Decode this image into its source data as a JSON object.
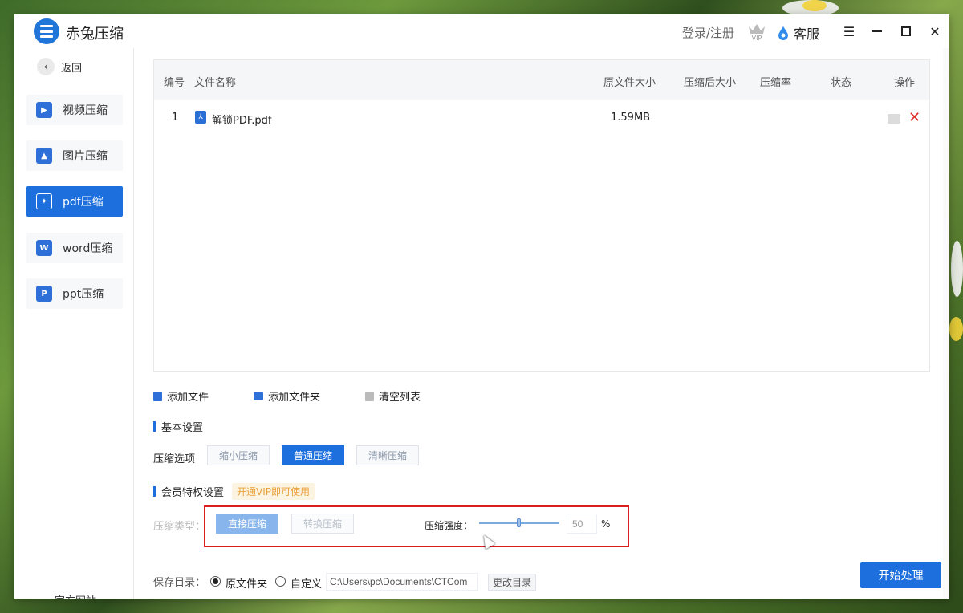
{
  "app": {
    "title": "赤兔压缩"
  },
  "header": {
    "login": "登录/注册",
    "vip_icon": "vip-crown-icon",
    "customer_service": "客服"
  },
  "sidebar": {
    "back": "返回",
    "items": [
      {
        "label": "视频压缩",
        "icon": "video-icon",
        "color": "#2f6fd8"
      },
      {
        "label": "图片压缩",
        "icon": "image-icon",
        "color": "#2f6fd8"
      },
      {
        "label": "pdf压缩",
        "icon": "pdf-icon",
        "color": "#ffffff",
        "active": true
      },
      {
        "label": "word压缩",
        "icon": "word-icon",
        "color": "#2f6fd8"
      },
      {
        "label": "ppt压缩",
        "icon": "ppt-icon",
        "color": "#2f6fd8"
      }
    ],
    "official_site": "官方网站"
  },
  "table": {
    "columns": [
      "编号",
      "文件名称",
      "原文件大小",
      "压缩后大小",
      "压缩率",
      "状态",
      "操作"
    ],
    "rows": [
      {
        "no": "1",
        "name": "解锁PDF.pdf",
        "original_size": "1.59MB",
        "compressed_size": "",
        "rate": "",
        "status": ""
      }
    ]
  },
  "actions": {
    "add_file": "添加文件",
    "add_folder": "添加文件夹",
    "clear_list": "清空列表"
  },
  "basic_settings": {
    "title": "基本设置",
    "option_label": "压缩选项",
    "options": [
      "缩小压缩",
      "普通压缩",
      "清晰压缩"
    ],
    "selected": "普通压缩"
  },
  "vip_settings": {
    "title": "会员特权设置",
    "tag": "开通VIP即可使用",
    "type_label": "压缩类型：",
    "types": [
      "直接压缩",
      "转换压缩"
    ],
    "strength_label": "压缩强度：",
    "strength_value": "50",
    "strength_unit": "%"
  },
  "save": {
    "label": "保存目录：",
    "option_original": "原文件夹",
    "option_custom": "自定义",
    "path": "C:\\Users\\pc\\Documents\\CTCom",
    "change_button": "更改目录"
  },
  "start_button": "开始处理",
  "colors": {
    "accent": "#1c6fdc",
    "danger": "#e02e2e",
    "vip": "#e8a13c"
  }
}
